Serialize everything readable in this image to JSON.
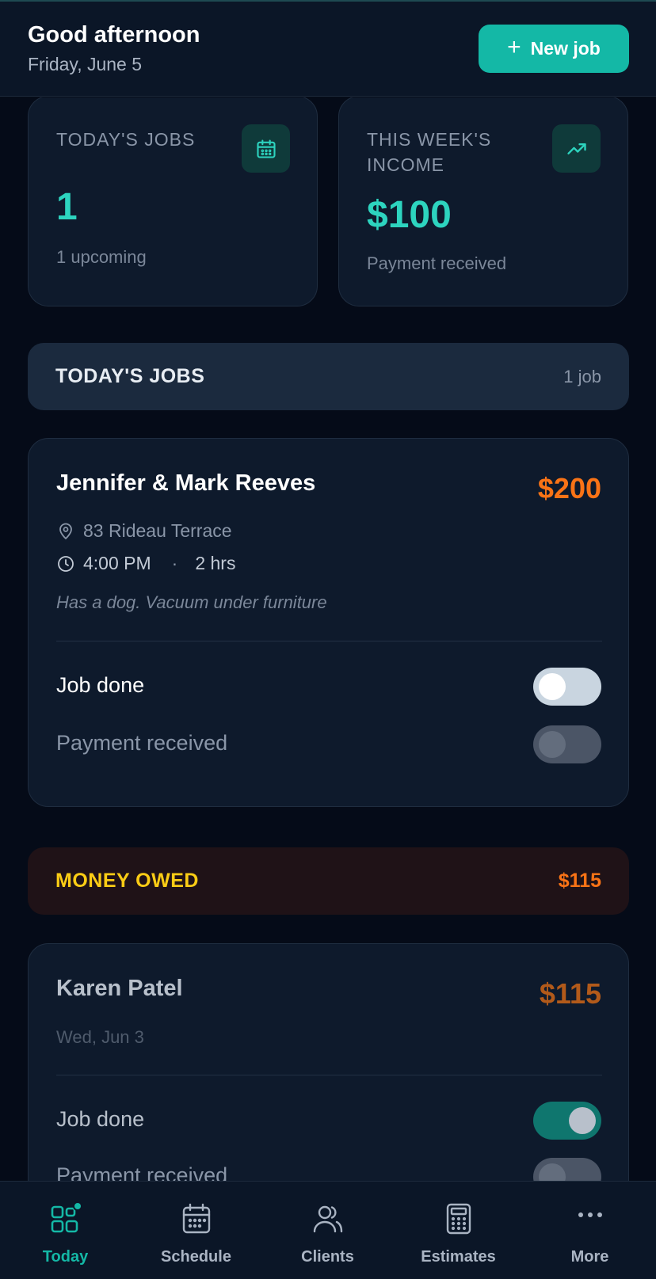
{
  "header": {
    "greeting": "Good afternoon",
    "date": "Friday, June 5",
    "new_job_label": "New job"
  },
  "stats": [
    {
      "label": "TODAY'S JOBS",
      "value": "1",
      "sub": "1 upcoming",
      "icon": "calendar-icon"
    },
    {
      "label": "THIS WEEK'S INCOME",
      "value": "$100",
      "sub": "Payment received",
      "icon": "trending-up-icon"
    }
  ],
  "today_section": {
    "title": "TODAY'S JOBS",
    "meta": "1 job"
  },
  "today_job": {
    "client": "Jennifer & Mark Reeves",
    "price": "$200",
    "address": "83 Rideau Terrace",
    "time": "4:00 PM",
    "separator": "·",
    "duration": "2 hrs",
    "note": "Has a dog. Vacuum under furniture",
    "job_done_label": "Job done",
    "job_done": false,
    "payment_label": "Payment received",
    "payment_received": false
  },
  "owed_section": {
    "title": "MONEY OWED",
    "amount": "$115"
  },
  "owed_job": {
    "client": "Karen Patel",
    "price": "$115",
    "date": "Wed, Jun 3",
    "job_done_label": "Job done",
    "job_done": true,
    "payment_label": "Payment received",
    "payment_received": false
  },
  "nav": [
    {
      "label": "Today",
      "icon": "today-grid-icon",
      "active": true
    },
    {
      "label": "Schedule",
      "icon": "calendar-icon",
      "active": false
    },
    {
      "label": "Clients",
      "icon": "users-icon",
      "active": false
    },
    {
      "label": "Estimates",
      "icon": "calculator-icon",
      "active": false
    },
    {
      "label": "More",
      "icon": "more-dots-icon",
      "active": false
    }
  ],
  "colors": {
    "accent": "#14b8a6",
    "accent_text": "#2dd4bf",
    "price_orange": "#f97316",
    "owed_yellow": "#facc15",
    "background": "#050b18",
    "card": "#0e1a2c"
  }
}
